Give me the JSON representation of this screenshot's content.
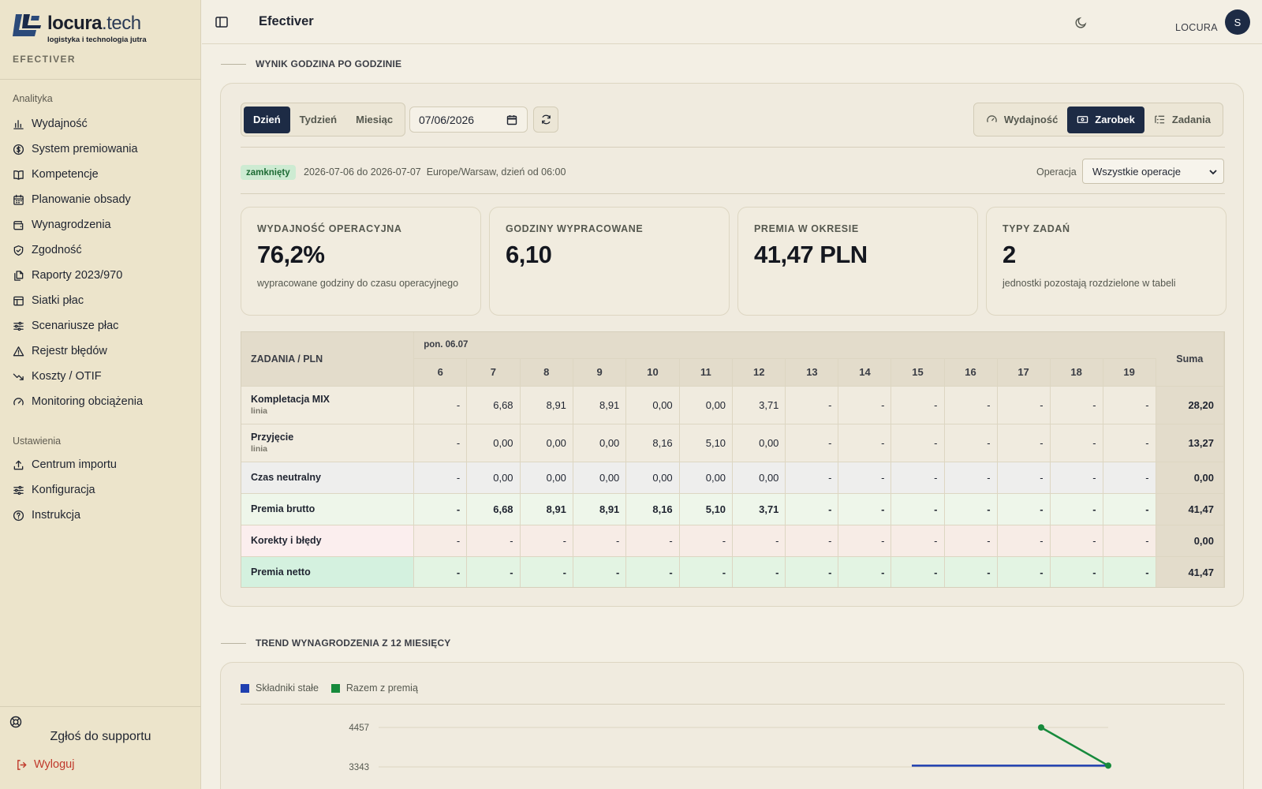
{
  "brand": {
    "name": "locura",
    "tld": ".tech",
    "tagline": "logistyka i technologia jutra",
    "app_caption": "EFECTIVER"
  },
  "sidebar": {
    "groups": [
      {
        "label": "Analityka",
        "items": [
          {
            "label": "Wydajność",
            "icon": "bar-chart-icon"
          },
          {
            "label": "System premiowania",
            "icon": "dollar-circle-icon"
          },
          {
            "label": "Kompetencje",
            "icon": "book-icon"
          },
          {
            "label": "Planowanie obsady",
            "icon": "calendar-icon"
          },
          {
            "label": "Wynagrodzenia",
            "icon": "wallet-icon"
          },
          {
            "label": "Zgodność",
            "icon": "shield-check-icon"
          },
          {
            "label": "Raporty 2023/970",
            "icon": "files-icon"
          },
          {
            "label": "Siatki płac",
            "icon": "table-icon"
          },
          {
            "label": "Scenariusze płac",
            "icon": "sliders-icon"
          },
          {
            "label": "Rejestr błędów",
            "icon": "warning-triangle-icon"
          },
          {
            "label": "Koszty / OTIF",
            "icon": "trend-down-icon"
          },
          {
            "label": "Monitoring obciążenia",
            "icon": "gauge-icon"
          }
        ]
      },
      {
        "label": "Ustawienia",
        "items": [
          {
            "label": "Centrum importu",
            "icon": "upload-icon"
          },
          {
            "label": "Konfiguracja",
            "icon": "sliders-icon"
          },
          {
            "label": "Instrukcja",
            "icon": "help-circle-icon"
          }
        ]
      }
    ],
    "support_label": "Zgłoś do supportu",
    "logout_label": "Wyloguj"
  },
  "topbar": {
    "title": "Efectiver",
    "user": "LOCURA",
    "avatar_initial": "S"
  },
  "section1": {
    "heading": "WYNIK GODZINA PO GODZINIE"
  },
  "controls": {
    "ranges": [
      "Dzień",
      "Tydzień",
      "Miesiąc"
    ],
    "active_range": "Dzień",
    "date_value": "07/06/2026",
    "modes": [
      "Wydajność",
      "Zarobek",
      "Zadania"
    ],
    "active_mode": "Zarobek"
  },
  "status": {
    "badge": "zamknięty",
    "period": "2026-07-06 do 2026-07-07",
    "timezone": "Europe/Warsaw, dzień od 06:00",
    "operation_label": "Operacja",
    "operation_value": "Wszystkie operacje"
  },
  "kpis": [
    {
      "label": "WYDAJNOŚĆ OPERACYJNA",
      "value": "76,2%",
      "note": "wypracowane godziny do czasu operacyjnego"
    },
    {
      "label": "GODZINY WYPRACOWANE",
      "value": "6,10",
      "note": ""
    },
    {
      "label": "PREMIA W OKRESIE",
      "value": "41,47 PLN",
      "note": ""
    },
    {
      "label": "TYPY ZADAŃ",
      "value": "2",
      "note": "jednostki pozostają rozdzielone w tabeli"
    }
  ],
  "table": {
    "task_header": "ZADANIA / PLN",
    "date_header": "pon. 06.07",
    "hours": [
      "6",
      "7",
      "8",
      "9",
      "10",
      "11",
      "12",
      "13",
      "14",
      "15",
      "16",
      "17",
      "18",
      "19"
    ],
    "sum_header": "Suma",
    "rows": [
      {
        "name": "Kompletacja MIX",
        "sub": "linia",
        "kind": "line",
        "cells": [
          "-",
          "6,68",
          "8,91",
          "8,91",
          "0,00",
          "0,00",
          "3,71",
          "-",
          "-",
          "-",
          "-",
          "-",
          "-",
          "-"
        ],
        "sum": "28,20"
      },
      {
        "name": "Przyjęcie",
        "sub": "linia",
        "kind": "line",
        "cells": [
          "-",
          "0,00",
          "0,00",
          "0,00",
          "8,16",
          "5,10",
          "0,00",
          "-",
          "-",
          "-",
          "-",
          "-",
          "-",
          "-"
        ],
        "sum": "13,27"
      },
      {
        "name": "Czas neutralny",
        "sub": "",
        "kind": "neutral",
        "cells": [
          "-",
          "0,00",
          "0,00",
          "0,00",
          "0,00",
          "0,00",
          "0,00",
          "-",
          "-",
          "-",
          "-",
          "-",
          "-",
          "-"
        ],
        "sum": "0,00"
      },
      {
        "name": "Premia brutto",
        "sub": "",
        "kind": "brutto",
        "cells": [
          "-",
          "6,68",
          "8,91",
          "8,91",
          "8,16",
          "5,10",
          "3,71",
          "-",
          "-",
          "-",
          "-",
          "-",
          "-",
          "-"
        ],
        "sum": "41,47"
      },
      {
        "name": "Korekty i błędy",
        "sub": "",
        "kind": "korekty",
        "cells": [
          "-",
          "-",
          "-",
          "-",
          "-",
          "-",
          "-",
          "-",
          "-",
          "-",
          "-",
          "-",
          "-",
          "-"
        ],
        "sum": "0,00"
      },
      {
        "name": "Premia netto",
        "sub": "",
        "kind": "netto",
        "cells": [
          "-",
          "-",
          "-",
          "-",
          "-",
          "-",
          "-",
          "-",
          "-",
          "-",
          "-",
          "-",
          "-",
          "-"
        ],
        "sum": "41,47"
      }
    ]
  },
  "section2": {
    "heading": "TREND WYNAGRODZENIA Z 12 MIESIĘCY"
  },
  "chart_data": {
    "type": "line",
    "title": "",
    "legend": "top-left",
    "series": [
      {
        "name": "Składniki stałe",
        "color": "#1f3fb0",
        "values": [
          3380,
          3380,
          3380
        ]
      },
      {
        "name": "Razem z premią",
        "color": "#178a3c",
        "values": [
          null,
          4457,
          3380
        ]
      }
    ],
    "y_ticks": [
      "4457",
      "3343"
    ],
    "grid": true
  }
}
